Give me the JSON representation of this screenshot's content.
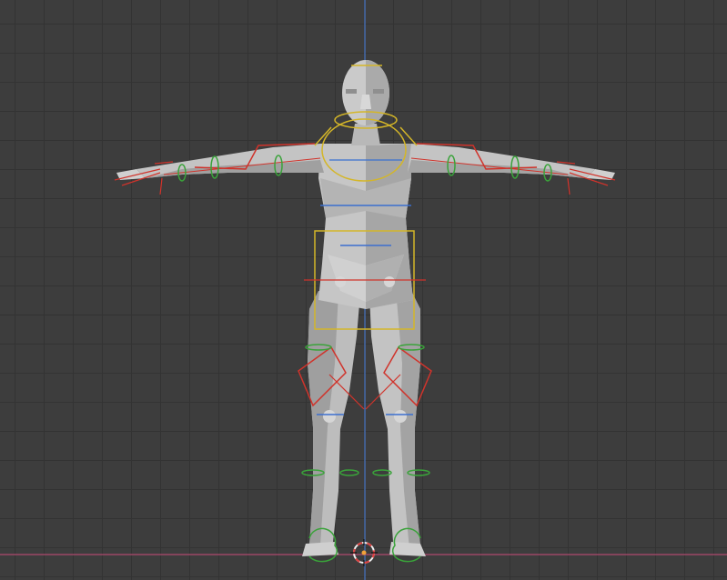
{
  "viewport": {
    "background": "#3d3d3d",
    "grid_color": "#333333",
    "z_axis_color": "#4a78c8",
    "x_axis_color": "#b04a6e"
  },
  "colors": {
    "mesh_light": "#c9c9c9",
    "mesh_mid": "#a9a9a9",
    "mesh_dark": "#8a8a8a",
    "mesh_shadow": "#707070",
    "bone_red": "#d0332b",
    "bone_yellow": "#d4b628",
    "bone_blue": "#3b6fcf",
    "bone_green": "#3aa33a",
    "cursor_red": "#e04040",
    "cursor_white": "#f0f0f0",
    "cursor_orange": "#f2a23a"
  },
  "icons": {
    "cursor": "3d-cursor-icon",
    "armature": "armature-icon",
    "mesh": "mesh-icon"
  }
}
